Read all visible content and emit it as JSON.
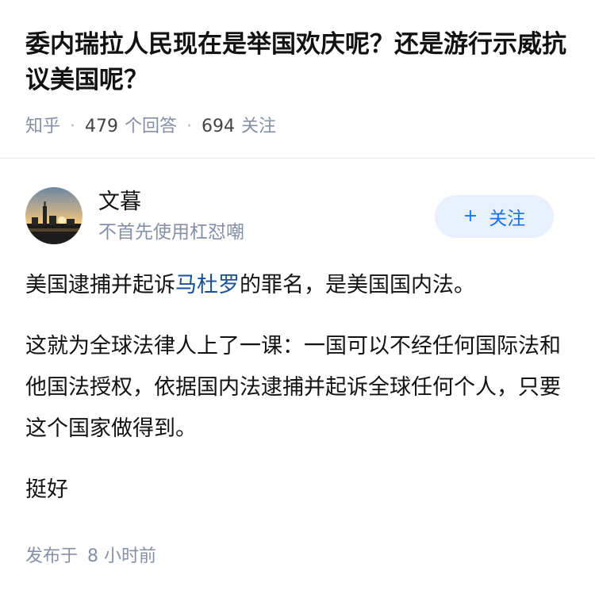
{
  "question": {
    "title": "委内瑞拉人民现在是举国欢庆呢？还是游行示威抗议美国呢？",
    "source": "知乎",
    "answer_count": "479",
    "answer_label": "个回答",
    "follower_count": "694",
    "follower_label": "关注"
  },
  "author": {
    "name": "文暮",
    "headline": "不首先使用杠怼嘲",
    "follow_plus": "+",
    "follow_label": "关注"
  },
  "answer": {
    "p1_before": "美国逮捕并起诉",
    "p1_link": "马杜罗",
    "p1_after": "的罪名，是美国国内法。",
    "p2": "这就为全球法律人上了一课：一国可以不经任何国际法和他国法授权，依据国内法逮捕并起诉全球任何个人，只要这个国家做得到。",
    "p3": "挺好"
  },
  "footer": {
    "published_label": "发布于",
    "published_time": "8 小时前"
  },
  "colors": {
    "meta_gray": "#8590a6",
    "link_blue": "#175199",
    "follow_blue": "#1772f6",
    "follow_bg": "#e8f1fb"
  }
}
